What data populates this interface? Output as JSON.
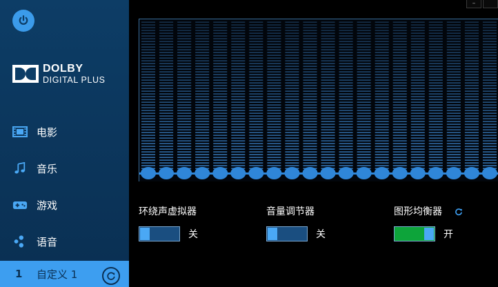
{
  "sidebar": {
    "logo": {
      "title": "DOLBY",
      "subtitle": "DIGITAL PLUS"
    },
    "items": [
      {
        "label": "电影",
        "icon": "film-icon"
      },
      {
        "label": "音乐",
        "icon": "music-note-icon"
      },
      {
        "label": "游戏",
        "icon": "gamepad-icon"
      },
      {
        "label": "语音",
        "icon": "voice-icon"
      }
    ],
    "custom": {
      "number": "1",
      "label": "自定义 1",
      "reset_icon": "reset-icon"
    }
  },
  "window": {
    "minimize": "–",
    "close": ""
  },
  "equalizer": {
    "bands": 20,
    "levels": [
      0,
      0,
      0,
      0,
      0,
      0,
      0,
      0,
      0,
      0,
      0,
      0,
      0,
      0,
      0,
      0,
      0,
      0,
      0,
      0
    ]
  },
  "controls": {
    "surround": {
      "label": "环绕声虚拟器",
      "state": "关",
      "on": false
    },
    "volume": {
      "label": "音量调节器",
      "state": "关",
      "on": false
    },
    "graphic_eq": {
      "label": "图形均衡器",
      "state": "开",
      "on": true
    }
  },
  "colors": {
    "sidebar": "#0d3d66",
    "accent": "#3d9ef0",
    "switch_off": "#1a4e80",
    "switch_on": "#0da43a"
  }
}
